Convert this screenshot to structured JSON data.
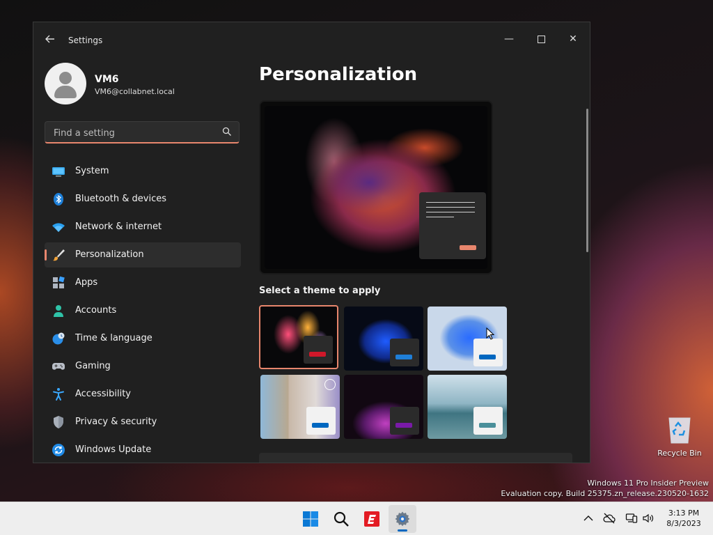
{
  "window": {
    "title": "Settings",
    "controls": {
      "minimize": "—",
      "close": "✕"
    }
  },
  "profile": {
    "name": "VM6",
    "email": "VM6@collabnet.local"
  },
  "search": {
    "placeholder": "Find a setting"
  },
  "nav": {
    "items": [
      {
        "label": "System",
        "icon": "monitor-icon"
      },
      {
        "label": "Bluetooth & devices",
        "icon": "bluetooth-icon"
      },
      {
        "label": "Network & internet",
        "icon": "wifi-icon"
      },
      {
        "label": "Personalization",
        "icon": "brush-icon",
        "active": true
      },
      {
        "label": "Apps",
        "icon": "apps-icon"
      },
      {
        "label": "Accounts",
        "icon": "person-icon"
      },
      {
        "label": "Time & language",
        "icon": "globe-clock-icon"
      },
      {
        "label": "Gaming",
        "icon": "gamepad-icon"
      },
      {
        "label": "Accessibility",
        "icon": "accessibility-icon"
      },
      {
        "label": "Privacy & security",
        "icon": "shield-icon"
      },
      {
        "label": "Windows Update",
        "icon": "update-icon"
      }
    ]
  },
  "content": {
    "page_title": "Personalization",
    "theme_section_title": "Select a theme to apply"
  },
  "desktop": {
    "recycle_bin_label": "Recycle Bin",
    "watermark_line1": "Windows 11 Pro Insider Preview",
    "watermark_line2": "Evaluation copy. Build 25375.zn_release.230520-1632"
  },
  "taskbar": {
    "time": "3:13 PM",
    "date": "8/3/2023"
  },
  "colors": {
    "accent": "#e8866d",
    "windows_blue": "#0067c0"
  }
}
